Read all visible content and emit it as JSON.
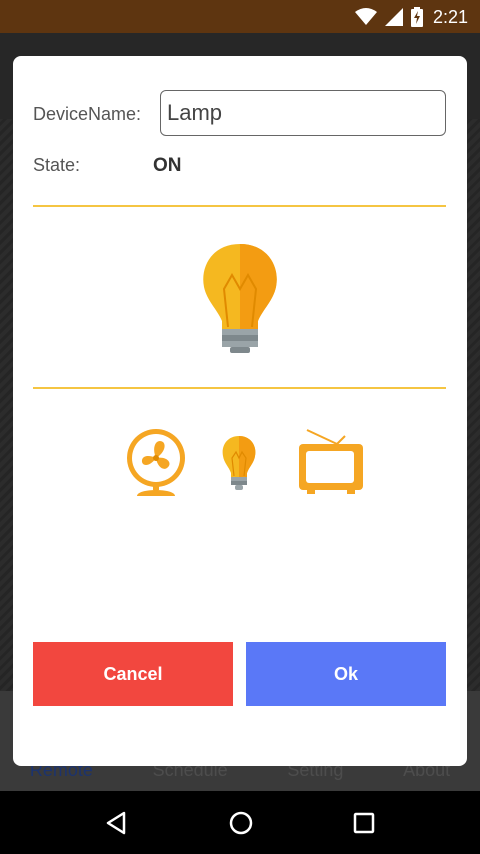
{
  "status_bar": {
    "time": "2:21"
  },
  "background_tabs": [
    "Remote",
    "Schedule",
    "Setting",
    "About"
  ],
  "dialog": {
    "device_name_label": "DeviceName:",
    "device_name_value": "Lamp",
    "state_label": "State:",
    "state_value": "ON",
    "selected_device_icon": "lightbulb-icon",
    "device_options": [
      "fan-icon",
      "lightbulb-icon",
      "tv-icon"
    ],
    "cancel_label": "Cancel",
    "ok_label": "Ok"
  },
  "colors": {
    "status_bar": "#5e3510",
    "divider": "#f5c542",
    "icon_orange": "#f5a623",
    "cancel_button": "#f2473f",
    "ok_button": "#5a78f7"
  }
}
